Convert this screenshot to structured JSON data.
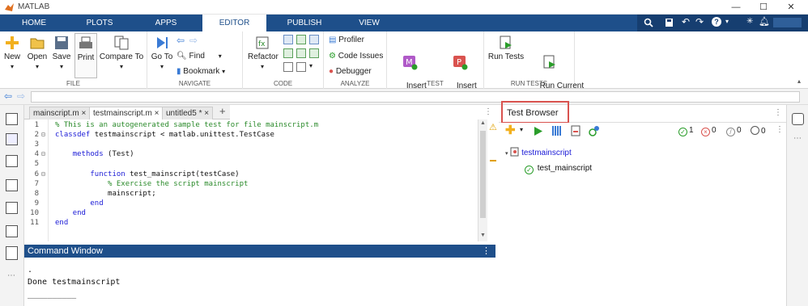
{
  "window": {
    "title": "MATLAB"
  },
  "tabs": [
    "HOME",
    "PLOTS",
    "APPS",
    "EDITOR",
    "PUBLISH",
    "VIEW"
  ],
  "active_tab": "EDITOR",
  "ribbon": {
    "file": {
      "label": "FILE",
      "new": "New",
      "open": "Open",
      "save": "Save",
      "print": "Print"
    },
    "compare": {
      "label": "Compare To"
    },
    "navigate": {
      "label": "NAVIGATE",
      "goto": "Go To",
      "find": "Find",
      "bookmark": "Bookmark"
    },
    "code": {
      "label": "CODE",
      "refactor": "Refactor"
    },
    "analyze": {
      "label": "ANALYZE",
      "profiler": "Profiler",
      "code_issues": "Code Issues",
      "debugger": "Debugger"
    },
    "test": {
      "label": "TEST",
      "insert_method": "Insert\nMethod",
      "insert_parameters": "Insert\nParameters"
    },
    "run_tests": {
      "label": "RUN TESTS",
      "run_tests": "Run Tests",
      "run_current": "Run Current\nTest"
    }
  },
  "editor": {
    "tabs": [
      "mainscript.m",
      "testmainscript.m",
      "untitled5 *"
    ],
    "active_tab": "testmainscript.m",
    "lines": [
      {
        "n": "1",
        "fold": "",
        "indent": "",
        "parts": [
          {
            "c": "cm",
            "t": "% This is an autogenerated sample test for file mainscript.m"
          }
        ]
      },
      {
        "n": "2",
        "fold": "⊟",
        "indent": "",
        "parts": [
          {
            "c": "kw",
            "t": "classdef"
          },
          {
            "c": "tx",
            "t": " testmainscript < matlab.unittest.TestCase"
          }
        ]
      },
      {
        "n": "3",
        "fold": "",
        "indent": "",
        "parts": []
      },
      {
        "n": "4",
        "fold": "⊟",
        "indent": "    ",
        "parts": [
          {
            "c": "kw",
            "t": "methods"
          },
          {
            "c": "tx",
            "t": " (Test)"
          }
        ]
      },
      {
        "n": "5",
        "fold": "",
        "indent": "",
        "parts": []
      },
      {
        "n": "6",
        "fold": "⊟",
        "indent": "        ",
        "parts": [
          {
            "c": "kw",
            "t": "function"
          },
          {
            "c": "tx",
            "t": " test_mainscript(testCase)"
          }
        ]
      },
      {
        "n": "7",
        "fold": "",
        "indent": "            ",
        "parts": [
          {
            "c": "cm",
            "t": "% Exercise the script mainscript"
          }
        ]
      },
      {
        "n": "8",
        "fold": "",
        "indent": "            ",
        "parts": [
          {
            "c": "tx",
            "t": "mainscript;"
          }
        ]
      },
      {
        "n": "9",
        "fold": "",
        "indent": "        ",
        "parts": [
          {
            "c": "kw",
            "t": "end"
          }
        ]
      },
      {
        "n": "10",
        "fold": "",
        "indent": "    ",
        "parts": [
          {
            "c": "kw",
            "t": "end"
          }
        ]
      },
      {
        "n": "11",
        "fold": "",
        "indent": "",
        "parts": [
          {
            "c": "kw",
            "t": "end"
          }
        ]
      }
    ]
  },
  "command_window": {
    "title": "Command Window",
    "lines": [
      ".",
      "Done testmainscript",
      "__________"
    ]
  },
  "test_browser": {
    "title": "Test Browser",
    "counts": {
      "passed": "1",
      "failed": "0",
      "incomplete": "0",
      "not_run": "0"
    },
    "root": "testmainscript",
    "child": "test_mainscript"
  },
  "colors": {
    "accent": "#1e4f8a",
    "highlight": "#d9534f",
    "pass": "#2a9d2a",
    "fail": "#d9534f"
  }
}
